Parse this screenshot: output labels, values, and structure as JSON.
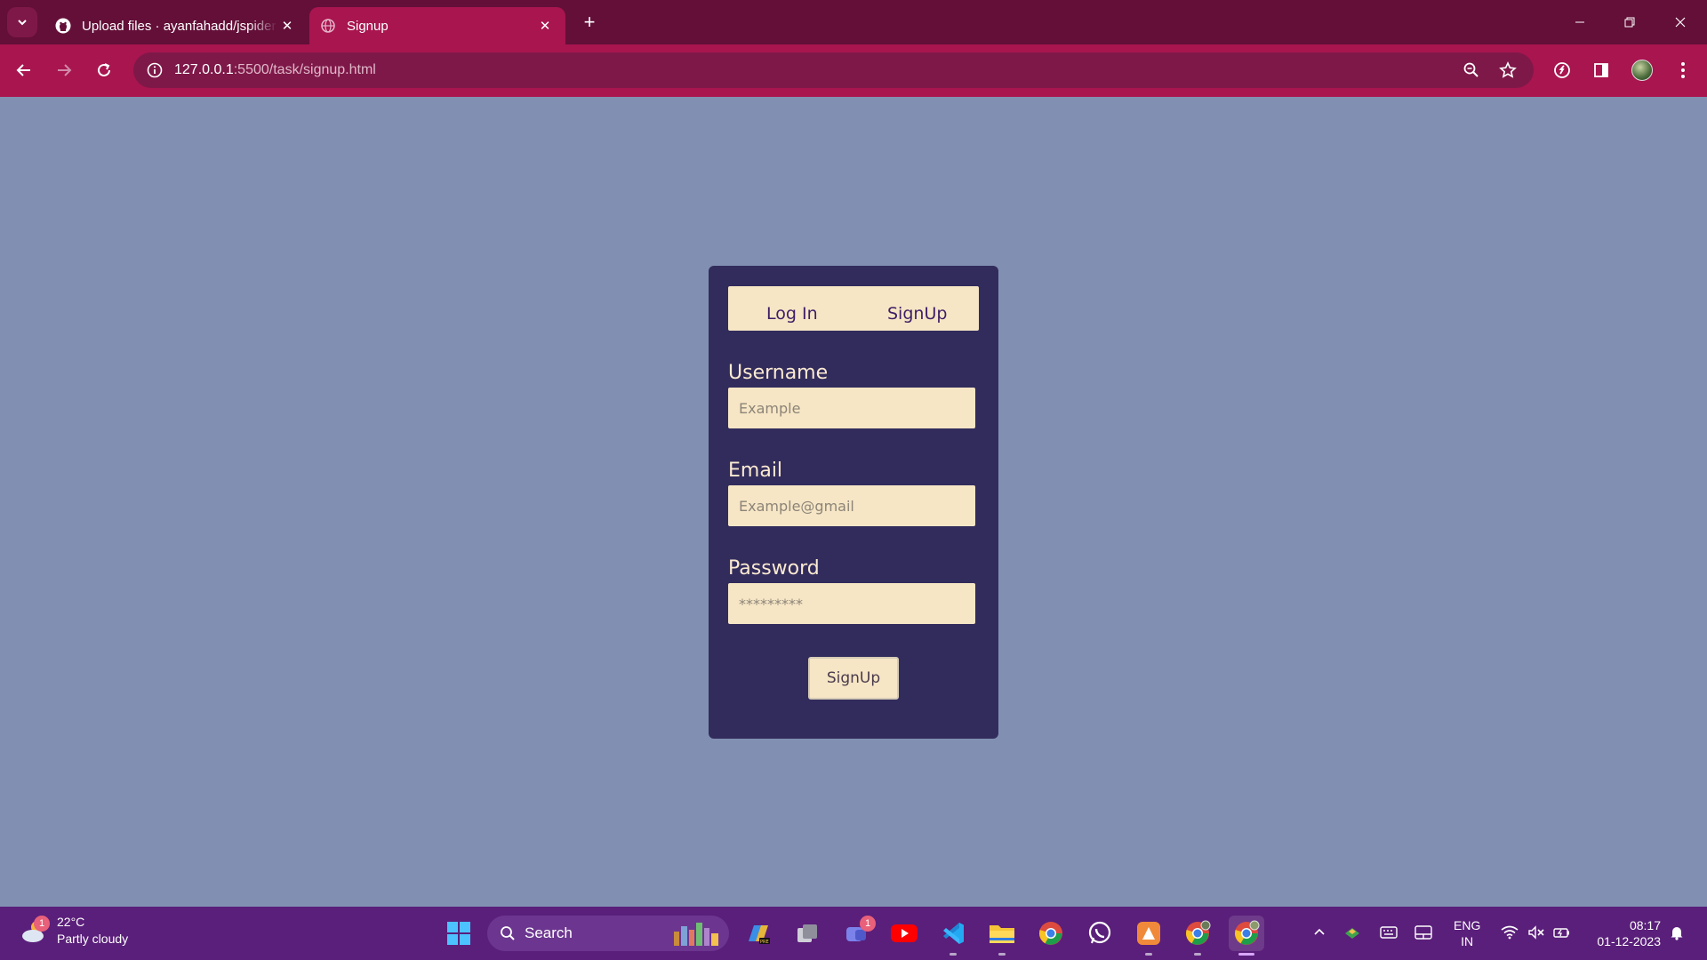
{
  "browser": {
    "tabs": [
      {
        "title": "Upload files · ayanfahadd/jspider",
        "icon": "github-icon"
      },
      {
        "title": "Signup",
        "icon": "globe-icon",
        "active": true
      }
    ],
    "url_host": "127.0.0.1",
    "url_rest": ":5500/task/signup.html",
    "accent": "#a8154f",
    "frame_color": "#630f38"
  },
  "page": {
    "background": "#8190b2",
    "card_color": "#322c5c",
    "tabs": {
      "login": "Log In",
      "signup": "SignUp"
    },
    "fields": {
      "username": {
        "label": "Username",
        "placeholder": "Example"
      },
      "email": {
        "label": "Email",
        "placeholder": "Example@gmail"
      },
      "password": {
        "label": "Password",
        "placeholder": "*********"
      }
    },
    "submit_label": "SignUp"
  },
  "taskbar": {
    "weather": {
      "temp": "22°C",
      "desc": "Partly cloudy",
      "badge": "1"
    },
    "search_label": "Search",
    "teams_badge": "1",
    "language": {
      "line1": "ENG",
      "line2": "IN"
    },
    "time": "08:17",
    "date": "01-12-2023"
  }
}
